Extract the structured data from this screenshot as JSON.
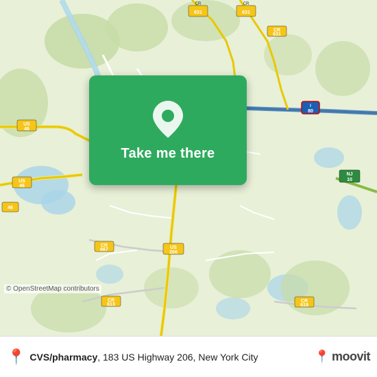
{
  "map": {
    "background_color": "#e8f0d8",
    "attribution": "© OpenStreetMap contributors"
  },
  "card": {
    "button_label": "Take me there",
    "background_color": "#2eaa5e"
  },
  "bottom_bar": {
    "location_name": "CVS/pharmacy",
    "location_address": ", 183 US Highway 206,",
    "location_city": " New York City",
    "logo_text": "moovit"
  },
  "roads": {
    "labels": [
      "CR 631",
      "CR 631",
      "US 46",
      "US 46",
      "I 80",
      "US 206",
      "CR 613",
      "CR 619",
      "CR 667",
      "NJ 10",
      "46",
      "CR"
    ]
  }
}
